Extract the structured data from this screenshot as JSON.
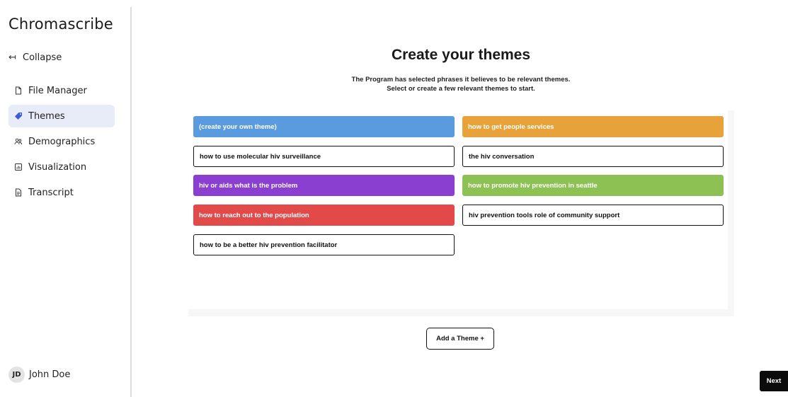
{
  "app": {
    "name": "Chromascribe"
  },
  "sidebar": {
    "collapse_label": "Collapse",
    "items": [
      {
        "label": "File Manager",
        "icon": "file-icon"
      },
      {
        "label": "Themes",
        "icon": "tag-icon",
        "active": true
      },
      {
        "label": "Demographics",
        "icon": "users-icon"
      },
      {
        "label": "Visualization",
        "icon": "chart-icon"
      },
      {
        "label": "Transcript",
        "icon": "document-icon"
      }
    ],
    "user": {
      "initials": "JD",
      "name": "John Doe"
    }
  },
  "main": {
    "title": "Create your themes",
    "subtitle_line1": "The Program has selected phrases it believes to be relevant themes.",
    "subtitle_line2": "Select or create a few relevant themes to start.",
    "themes": [
      {
        "label": "(create your own theme)",
        "color": "#5a9be0",
        "selected": true
      },
      {
        "label": "how to get people services",
        "color": "#e8a23a",
        "selected": true
      },
      {
        "label": "how to use molecular hiv surveillance",
        "selected": false
      },
      {
        "label": "the hiv conversation",
        "selected": false
      },
      {
        "label": "hiv or aids what is the problem",
        "color": "#8a3fd0",
        "selected": true
      },
      {
        "label": "how to promote hiv prevention in seattle",
        "color": "#8dc153",
        "selected": true
      },
      {
        "label": "how to reach out to the population",
        "color": "#e24a4a",
        "selected": true
      },
      {
        "label": "hiv prevention tools role of community support",
        "selected": false
      },
      {
        "label": "how to be a better hiv prevention facilitator",
        "selected": false
      }
    ],
    "add_theme_label": "Add a Theme +",
    "next_label": "Next"
  }
}
